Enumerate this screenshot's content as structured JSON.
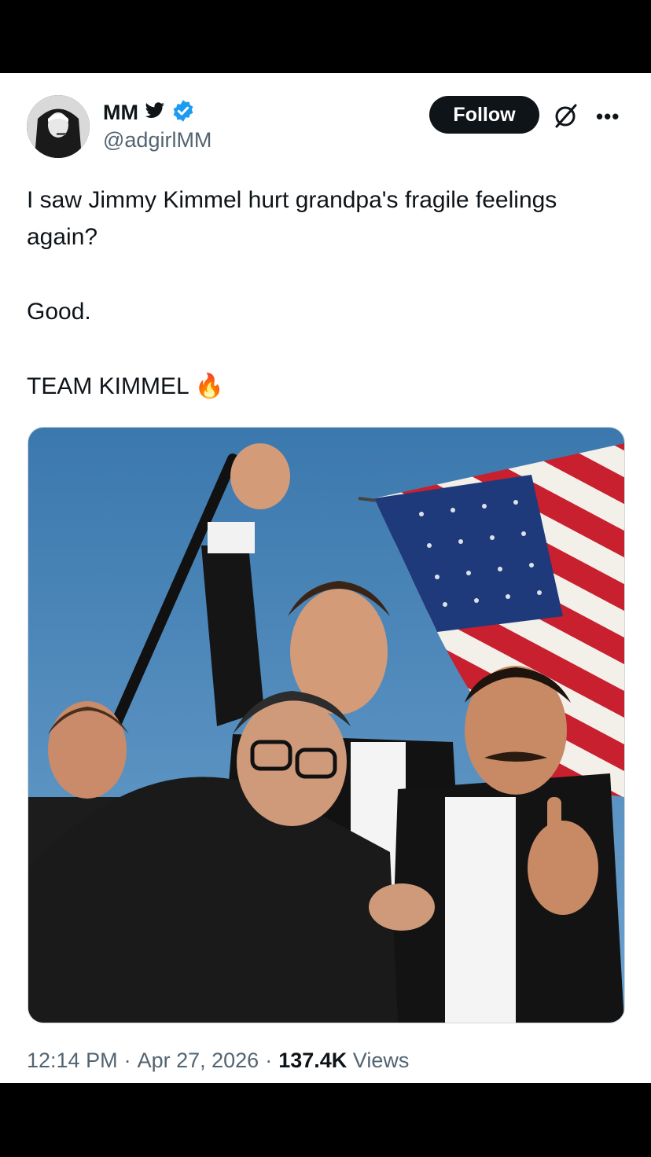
{
  "tweet": {
    "author_name": "MM",
    "author_handle": "@adgirlMM",
    "follow_label": "Follow",
    "text_lines": [
      "I saw Jimmy Kimmel hurt grandpa's fragile feelings again?",
      "Good.",
      "TEAM KIMMEL"
    ],
    "emoji": "🔥",
    "time": "12:14 PM",
    "separator": "·",
    "date": "Apr 27, 2026",
    "views_count": "137.4K",
    "views_label": "Views"
  },
  "icons": {
    "bird": "twitter-bird-icon",
    "verified": "verified-badge-icon",
    "grok": "grok-icon",
    "more": "more-options-icon"
  },
  "colors": {
    "accent_blue": "#1d9bf0",
    "text_primary": "#0f1419",
    "text_secondary": "#536471",
    "follow_bg": "#0f1419",
    "sky": "#3f7fb4"
  }
}
